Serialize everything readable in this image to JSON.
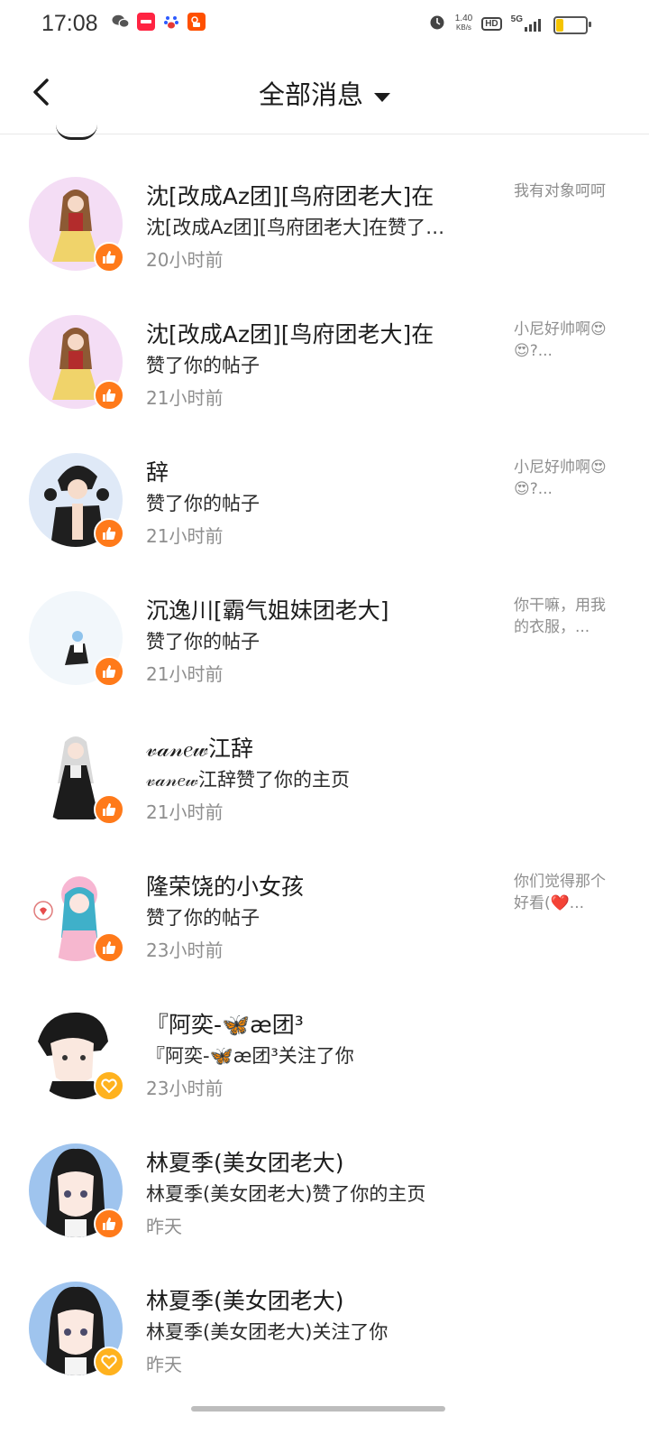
{
  "status_bar": {
    "time": "17:08",
    "speed_value": "1.40",
    "speed_unit": "KB/s",
    "hd": "HD",
    "network": "5G",
    "app_icons": [
      "wechat-icon",
      "xiaohongshu-icon",
      "baidu-icon",
      "kuaishou-icon"
    ]
  },
  "header": {
    "title": "全部消息"
  },
  "colors": {
    "like_badge": "#ff7a1a",
    "follow_badge": "#ffb21e",
    "time_text": "#8e8e8e"
  },
  "messages": [
    {
      "name": "沈[改成Az团][鸟府团老大]在",
      "desc": "沈[改成Az团][鸟府团老大]在赞了…",
      "time": "20小时前",
      "preview": "我有对象呵呵",
      "badge": "like-icon",
      "avatar_bg": "#f7e6f7"
    },
    {
      "name": "沈[改成Az团][鸟府团老大]在",
      "desc": "赞了你的帖子",
      "time": "21小时前",
      "preview": "小尼好帅啊😍😍?...",
      "badge": "like-icon",
      "avatar_bg": "#f7e6f7"
    },
    {
      "name": "辞",
      "desc": "赞了你的帖子",
      "time": "21小时前",
      "preview": "小尼好帅啊😍😍?...",
      "badge": "like-icon",
      "avatar_bg": "#dfe9f7"
    },
    {
      "name": "沉逸川[霸气姐妹团老大]",
      "desc": "赞了你的帖子",
      "time": "21小时前",
      "preview": "你干嘛，用我的衣服，...",
      "badge": "like-icon",
      "avatar_bg": "#f2f7fb"
    },
    {
      "name": "𝓋𝒶𝓃𝑒𝓌江辞",
      "desc": "𝓋𝒶𝓃𝑒𝓌江辞赞了你的主页",
      "time": "21小时前",
      "preview": "",
      "badge": "like-icon",
      "avatar_bg": "#ffffff"
    },
    {
      "name": "隆荣饶的小女孩",
      "desc": "赞了你的帖子",
      "time": "23小时前",
      "preview": "你们觉得那个好看(❤️...",
      "badge": "like-icon",
      "avatar_bg": "#ffffff"
    },
    {
      "name": "『阿奕-🦋æ团³",
      "desc": "『阿奕-🦋æ团³关注了你",
      "time": "23小时前",
      "preview": "",
      "badge": "heart-icon",
      "avatar_bg": "#ffffff"
    },
    {
      "name": "林夏季(美女团老大)",
      "desc": "林夏季(美女团老大)赞了你的主页",
      "time": "昨天",
      "preview": "",
      "badge": "like-icon",
      "avatar_bg": "#9fc4ee"
    },
    {
      "name": "林夏季(美女团老大)",
      "desc": "林夏季(美女团老大)关注了你",
      "time": "昨天",
      "preview": "",
      "badge": "heart-icon",
      "avatar_bg": "#9fc4ee"
    }
  ]
}
